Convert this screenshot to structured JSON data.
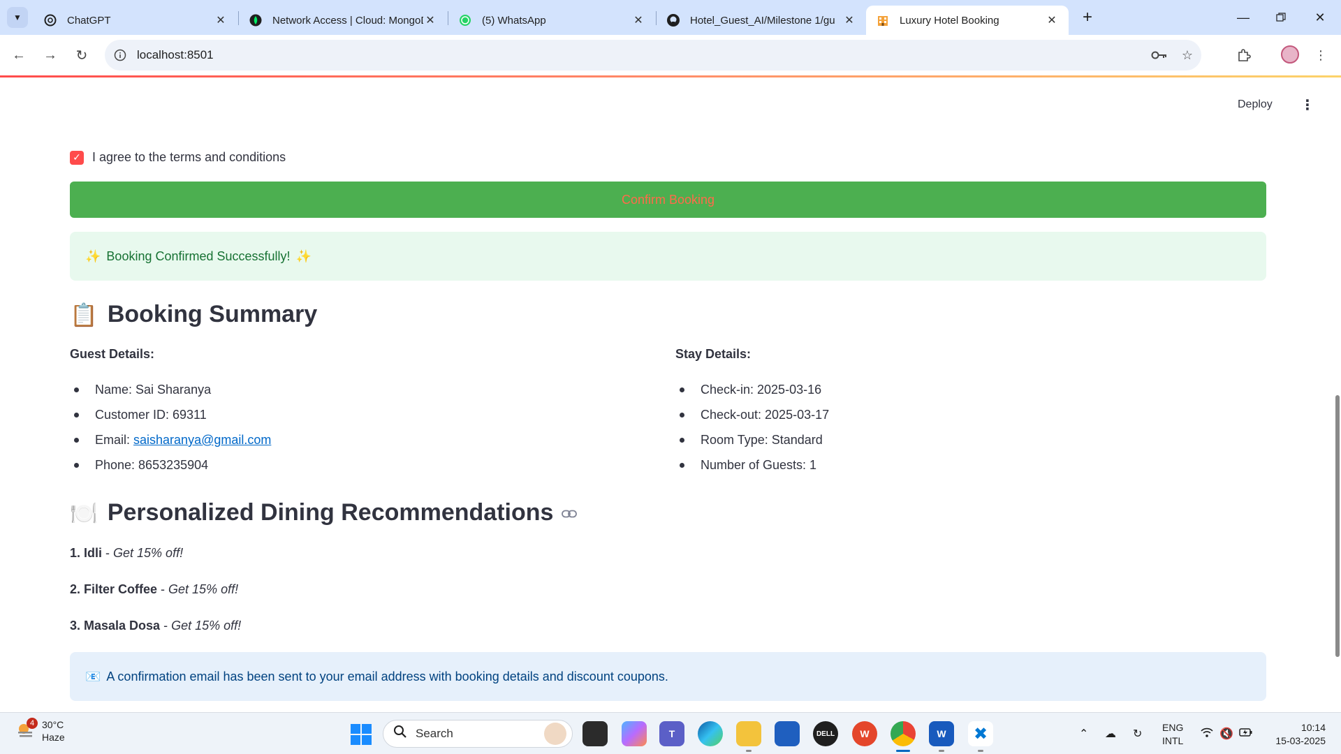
{
  "browser": {
    "tabs": [
      {
        "title": "ChatGPT",
        "icon": "chatgpt-icon"
      },
      {
        "title": "Network Access | Cloud: MongoDB",
        "icon": "mongodb-leaf-icon"
      },
      {
        "title": "(5) WhatsApp",
        "icon": "whatsapp-icon"
      },
      {
        "title": "Hotel_Guest_AI/Milestone 1/gu",
        "icon": "github-icon"
      },
      {
        "title": "Luxury Hotel Booking",
        "icon": "hotel-building-icon"
      }
    ],
    "url": "localhost:8501"
  },
  "app": {
    "deploy_label": "Deploy",
    "agree_label": "I agree to the terms and conditions",
    "agree_checked": true,
    "confirm_button": "Confirm Booking",
    "success_message": "Booking Confirmed Successfully!",
    "success_emoji": "✨",
    "summary": {
      "heading": "Booking Summary",
      "emoji": "📋",
      "guest_title": "Guest Details:",
      "guest": {
        "name": "Name: Sai Sharanya",
        "customer_id": "Customer ID: 69311",
        "email_prefix": "Email: ",
        "email": "saisharanya@gmail.com",
        "phone": "Phone: 8653235904"
      },
      "stay_title": "Stay Details:",
      "stay": {
        "checkin": "Check-in: 2025-03-16",
        "checkout": "Check-out: 2025-03-17",
        "room": "Room Type: Standard",
        "guests": "Number of Guests: 1"
      }
    },
    "dining": {
      "heading": "Personalized Dining Recommendations",
      "emoji": "🍽️",
      "items": [
        {
          "name": "1. Idli",
          "offer": "Get 15% off!"
        },
        {
          "name": "2. Filter Coffee",
          "offer": "Get 15% off!"
        },
        {
          "name": "3. Masala Dosa",
          "offer": "Get 15% off!"
        }
      ]
    },
    "email_notice": "A confirmation email has been sent to your email address with booking details and discount coupons.",
    "email_emoji": "📧"
  },
  "taskbar": {
    "weather_temp": "30°C",
    "weather_desc": "Haze",
    "weather_badge": "4",
    "search_label": "Search",
    "lang_top": "ENG",
    "lang_bottom": "INTL",
    "time": "10:14",
    "date": "15-03-2025"
  }
}
